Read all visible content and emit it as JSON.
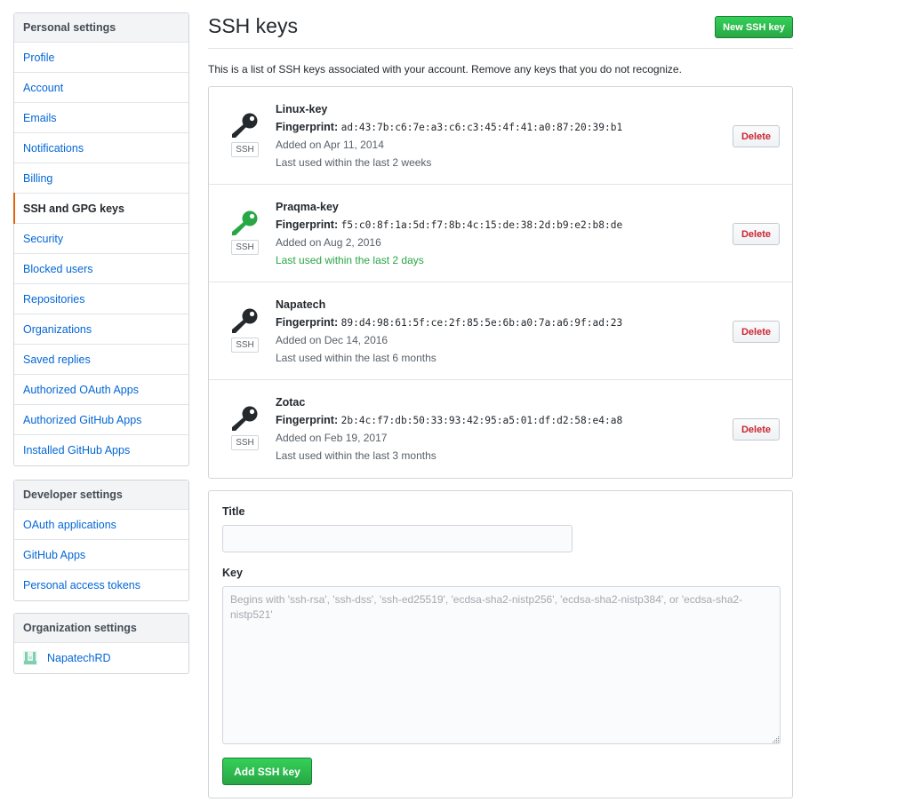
{
  "sidebar": {
    "personal": {
      "heading": "Personal settings",
      "items": [
        {
          "label": "Profile"
        },
        {
          "label": "Account"
        },
        {
          "label": "Emails"
        },
        {
          "label": "Notifications"
        },
        {
          "label": "Billing"
        },
        {
          "label": "SSH and GPG keys",
          "selected": true
        },
        {
          "label": "Security"
        },
        {
          "label": "Blocked users"
        },
        {
          "label": "Repositories"
        },
        {
          "label": "Organizations"
        },
        {
          "label": "Saved replies"
        },
        {
          "label": "Authorized OAuth Apps"
        },
        {
          "label": "Authorized GitHub Apps"
        },
        {
          "label": "Installed GitHub Apps"
        }
      ]
    },
    "developer": {
      "heading": "Developer settings",
      "items": [
        {
          "label": "OAuth applications"
        },
        {
          "label": "GitHub Apps"
        },
        {
          "label": "Personal access tokens"
        }
      ]
    },
    "organization": {
      "heading": "Organization settings",
      "items": [
        {
          "label": "NapatechRD",
          "icon": "org-avatar-icon"
        }
      ]
    }
  },
  "main": {
    "title": "SSH keys",
    "new_key_label": "New SSH key",
    "intro": "This is a list of SSH keys associated with your account. Remove any keys that you do not recognize.",
    "keys": [
      {
        "title": "Linux-key",
        "fingerprint_label": "Fingerprint:",
        "fingerprint": "ad:43:7b:c6:7e:a3:c6:c3:45:4f:41:a0:87:20:39:b1",
        "added": "Added on Apr 11, 2014",
        "last_used": "Last used within the last 2 weeks",
        "recent": false,
        "badge": "SSH",
        "delete_label": "Delete"
      },
      {
        "title": "Praqma-key",
        "fingerprint_label": "Fingerprint:",
        "fingerprint": "f5:c0:8f:1a:5d:f7:8b:4c:15:de:38:2d:b9:e2:b8:de",
        "added": "Added on Aug 2, 2016",
        "last_used": "Last used within the last 2 days",
        "recent": true,
        "badge": "SSH",
        "delete_label": "Delete"
      },
      {
        "title": "Napatech",
        "fingerprint_label": "Fingerprint:",
        "fingerprint": "89:d4:98:61:5f:ce:2f:85:5e:6b:a0:7a:a6:9f:ad:23",
        "added": "Added on Dec 14, 2016",
        "last_used": "Last used within the last 6 months",
        "recent": false,
        "badge": "SSH",
        "delete_label": "Delete"
      },
      {
        "title": "Zotac",
        "fingerprint_label": "Fingerprint:",
        "fingerprint": "2b:4c:f7:db:50:33:93:42:95:a5:01:df:d2:58:e4:a8",
        "added": "Added on Feb 19, 2017",
        "last_used": "Last used within the last 3 months",
        "recent": false,
        "badge": "SSH",
        "delete_label": "Delete"
      }
    ],
    "form": {
      "title_label": "Title",
      "title_value": "",
      "key_label": "Key",
      "key_value": "",
      "key_placeholder": "Begins with 'ssh-rsa', 'ssh-dss', 'ssh-ed25519', 'ecdsa-sha2-nistp256', 'ecdsa-sha2-nistp384', or 'ecdsa-sha2-nistp521'",
      "submit_label": "Add SSH key"
    }
  },
  "colors": {
    "link": "#0366d6",
    "selected_accent": "#e36209",
    "primary_button": "#28a745",
    "danger": "#cb2431",
    "recent_key_icon": "#28a745",
    "key_icon": "#24292e"
  }
}
